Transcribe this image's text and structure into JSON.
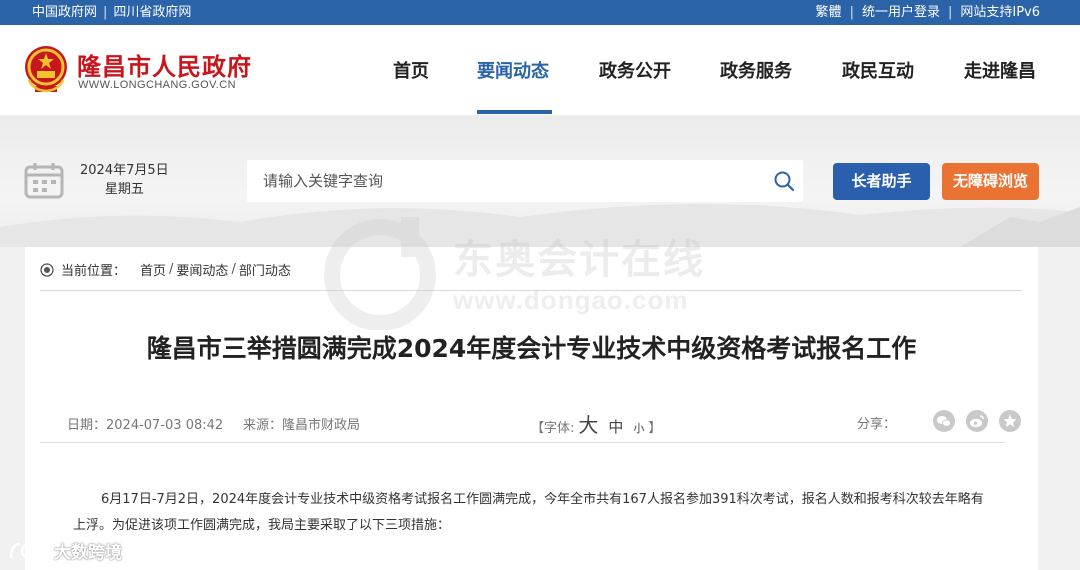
{
  "topbar": {
    "links_left": [
      "中国政府网",
      "四川省政府网"
    ],
    "links_right": [
      "繁體",
      "统一用户登录",
      "网站支持IPv6"
    ],
    "background": "#2a63a8"
  },
  "header": {
    "site_name": "隆昌市人民政府",
    "site_url": "WWW.LONGCHANG.GOV.CN",
    "emblem_icon": "national-emblem-icon"
  },
  "nav": {
    "items": [
      {
        "label": "首页",
        "active": false
      },
      {
        "label": "要闻动态",
        "active": true
      },
      {
        "label": "政务公开",
        "active": false
      },
      {
        "label": "政务服务",
        "active": false
      },
      {
        "label": "政民互动",
        "active": false
      },
      {
        "label": "走进隆昌",
        "active": false
      }
    ],
    "active_color": "#2a63a8"
  },
  "search_band": {
    "date": "2024年7月5日",
    "weekday": "星期五",
    "search_placeholder": "请输入关键字查询",
    "elder_button": "长者助手",
    "accessible_button": "无障碍浏览",
    "elder_color": "#2a5fae",
    "accessible_color": "#ea7334"
  },
  "breadcrumb": {
    "label": "当前位置：",
    "items": [
      "首页",
      "要闻动态",
      "部门动态"
    ]
  },
  "article": {
    "title": "隆昌市三举措圆满完成2024年度会计专业技术中级资格考试报名工作",
    "date_label": "日期：",
    "date": "2024-07-03 08:42",
    "source_label": "来源：",
    "source": "隆昌市财政局",
    "font_label_open": "【字体:",
    "font_big": "大",
    "font_mid": "中",
    "font_small": "小",
    "font_label_close": "】",
    "share_label": "分享：",
    "share_icons": [
      "wechat-icon",
      "weibo-icon",
      "favorite-icon"
    ],
    "paragraph": "6月17日-7月2日，2024年度会计专业技术中级资格考试报名工作圆满完成，今年全市共有167人报名参加391科次考试，报名人数和报考科次较去年略有上浮。为促进该项工作圆满完成，我局主要采取了以下三项措施："
  },
  "watermark": {
    "text_cn": "东奥会计在线",
    "text_url": "www.dongao.com",
    "bottom_text": "大数跨境"
  }
}
